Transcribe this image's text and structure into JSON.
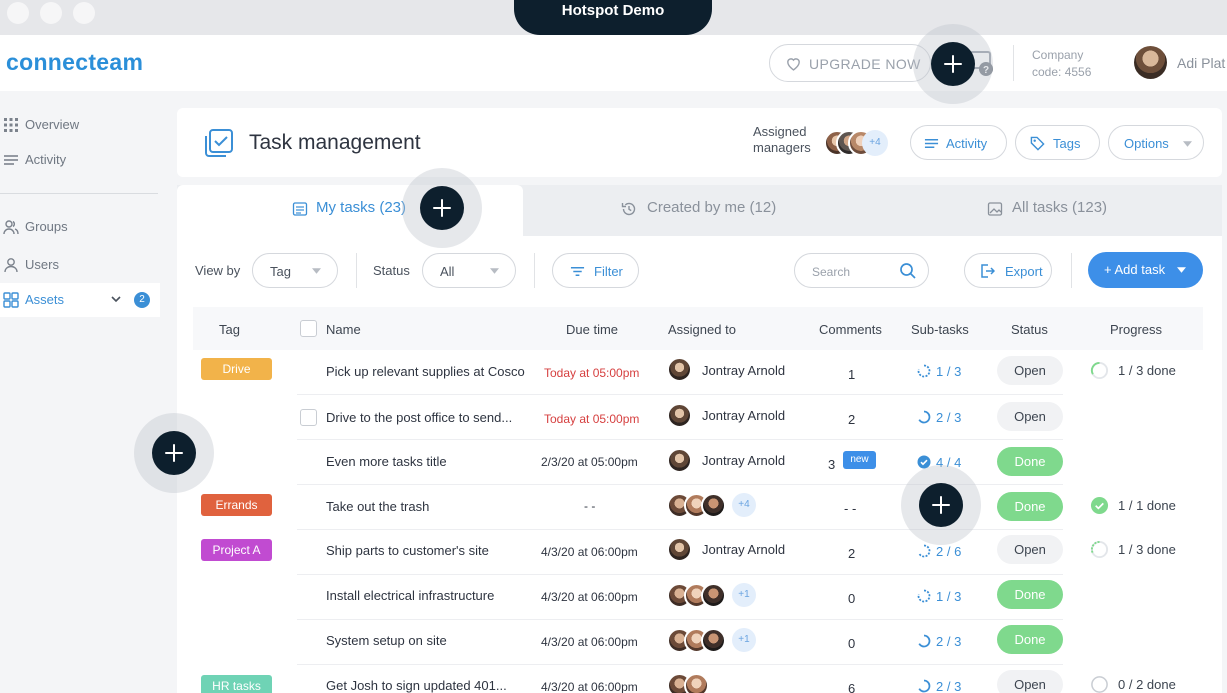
{
  "demo_label": "Hotspot Demo",
  "brand": {
    "logo": "connecteam",
    "accent": "#3d8fe8"
  },
  "topbar": {
    "upgrade_label": "UPGRADE NOW",
    "company_line1": "Company",
    "company_line2": "code: 4556",
    "user_name": "Adi Plat"
  },
  "sidebar": {
    "items": [
      {
        "label": "Overview",
        "icon": "grid-icon"
      },
      {
        "label": "Activity",
        "icon": "menu-lines-icon"
      },
      {
        "label": "Groups",
        "icon": "groups-icon"
      },
      {
        "label": "Users",
        "icon": "user-icon"
      },
      {
        "label": "Assets",
        "icon": "assets-icon",
        "badge": "2",
        "active": true
      }
    ]
  },
  "header": {
    "title": "Task management",
    "assigned_line1": "Assigned",
    "assigned_line2": "managers",
    "managers_more": "+4",
    "activity_label": "Activity",
    "tags_label": "Tags",
    "options_label": "Options"
  },
  "tabs": [
    {
      "label": "My tasks (23)",
      "active": true
    },
    {
      "label": "Created by me (12)"
    },
    {
      "label": "All tasks (123)"
    }
  ],
  "filters": {
    "view_by_label": "View by",
    "view_by_value": "Tag",
    "status_label": "Status",
    "status_value": "All",
    "filter_label": "Filter",
    "search_placeholder": "Search",
    "export_label": "Export",
    "add_task_label": "+ Add task"
  },
  "table": {
    "columns": [
      "Tag",
      "Name",
      "Due time",
      "Assigned to",
      "Comments",
      "Sub-tasks",
      "Status",
      "Progress"
    ],
    "rows": [
      {
        "tag": "Drive",
        "tag_color": "#f2b34a",
        "name": "Pick up relevant supplies at Cosco",
        "due": "Today at 05:00pm",
        "due_red": true,
        "assignee": "Jontray Arnold",
        "comments": "1",
        "subtasks": "1 / 3",
        "status": "Open",
        "progress": "1 / 3 done"
      },
      {
        "tag": "",
        "name": "Drive to the post office to send...",
        "checkbox": true,
        "due": "Today at 05:00pm",
        "due_red": true,
        "assignee": "Jontray Arnold",
        "comments": "2",
        "subtasks": "2 / 3",
        "status": "Open",
        "progress": ""
      },
      {
        "tag": "",
        "name": "Even more tasks title",
        "due": "2/3/20 at 05:00pm",
        "assignee": "Jontray Arnold",
        "comments": "3",
        "new_badge": "new",
        "subtasks": "4 / 4",
        "status": "Done",
        "progress": ""
      },
      {
        "tag": "Errands",
        "tag_color": "#e0623e",
        "name": "Take out the trash",
        "due": "- -",
        "assignee_more": "+4",
        "comments": "- -",
        "subtasks": "",
        "status": "Done",
        "progress": "1 / 1 done"
      },
      {
        "tag": "Project A",
        "tag_color": "#c14bd1",
        "name": "Ship parts to customer's site",
        "due": "4/3/20 at 06:00pm",
        "assignee": "Jontray Arnold",
        "comments": "2",
        "subtasks": "2 / 6",
        "status": "Open",
        "progress": "1 / 3 done"
      },
      {
        "tag": "",
        "name": "Install electrical infrastructure",
        "due": "4/3/20 at 06:00pm",
        "assignee_more": "+1",
        "comments": "0",
        "subtasks": "1 / 3",
        "status": "Done",
        "progress": ""
      },
      {
        "tag": "",
        "name": "System setup on site",
        "due": "4/3/20 at 06:00pm",
        "assignee_more": "+1",
        "comments": "0",
        "subtasks": "2 / 3",
        "status": "Done",
        "progress": ""
      },
      {
        "tag": "HR tasks",
        "tag_color": "#6fd3b5",
        "name": "Get Josh to sign updated 401...",
        "due": "4/3/20 at 06:00pm",
        "comments": "6",
        "subtasks": "2 / 3",
        "status": "Open",
        "progress": "0 / 2 done"
      }
    ]
  },
  "colors": {
    "open_bg": "#f1f2f4",
    "done_bg": "#7fd98d",
    "due_red": "#d64040",
    "hotspot": "#0d1f2d"
  }
}
